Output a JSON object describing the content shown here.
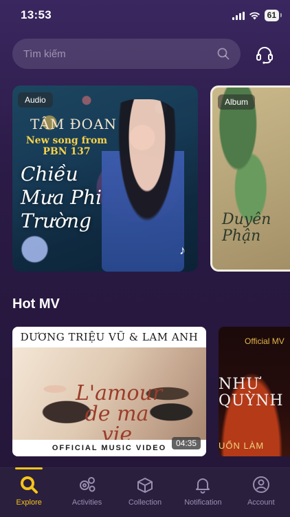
{
  "status": {
    "time": "13:53",
    "battery": "61"
  },
  "search": {
    "placeholder": "Tìm kiếm"
  },
  "featured": [
    {
      "badge": "Audio",
      "artist": "TÂM ĐOAN",
      "subtitle": "New song from PBN 137",
      "title": "Chiều Mưa Phi Trường",
      "icon": "music-note-icon"
    },
    {
      "badge": "Album",
      "title": "Duyên Phận"
    }
  ],
  "hot_mv": {
    "title": "Hot MV",
    "items": [
      {
        "header": "DƯƠNG TRIỆU VŨ & LAM ANH",
        "script_title": "L'amour de ma vie",
        "footer": "OFFICIAL MUSIC VIDEO",
        "duration": "04:35"
      },
      {
        "tag": "Official MV",
        "title": "NHƯ QUỲNH",
        "bottom": "UỔN LÀM"
      }
    ]
  },
  "tabs": [
    {
      "label": "Explore",
      "icon": "search-icon",
      "active": true
    },
    {
      "label": "Activities",
      "icon": "gears-icon",
      "active": false
    },
    {
      "label": "Collection",
      "icon": "box-icon",
      "active": false
    },
    {
      "label": "Notification",
      "icon": "bell-icon",
      "active": false
    },
    {
      "label": "Account",
      "icon": "user-circle-icon",
      "active": false
    }
  ],
  "colors": {
    "accent": "#f5c518",
    "background": "#2a1a45",
    "tab_inactive": "#9a8fb0"
  }
}
